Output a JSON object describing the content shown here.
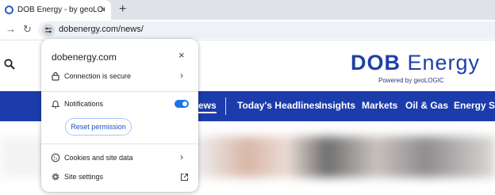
{
  "browser": {
    "tab": {
      "title": "DOB Energy - by geoLOGIC | N",
      "close_glyph": "×"
    },
    "new_tab_glyph": "+",
    "nav": {
      "forward_glyph": "→",
      "reload_glyph": "↻"
    },
    "url": "dobenergy.com/news/"
  },
  "site": {
    "logo": {
      "prefix": "DOB",
      "main": " Energy",
      "sub": "Powered by geoLOGIC"
    },
    "nav_items": [
      "ews",
      "Today's Headlines",
      "Insights",
      "Markets",
      "Oil & Gas",
      "Energy Ser"
    ],
    "nav_color": "#1b3caa"
  },
  "popup": {
    "title": "dobenergy.com",
    "close_glyph": "×",
    "connection": {
      "label": "Connection is secure",
      "chevron": "›"
    },
    "notifications": {
      "label": "Notifications",
      "enabled": true
    },
    "reset_button": "Reset permission",
    "cookies": {
      "label": "Cookies and site data",
      "chevron": "›"
    },
    "site_settings": {
      "label": "Site settings"
    },
    "accent": "#1a73e8"
  }
}
